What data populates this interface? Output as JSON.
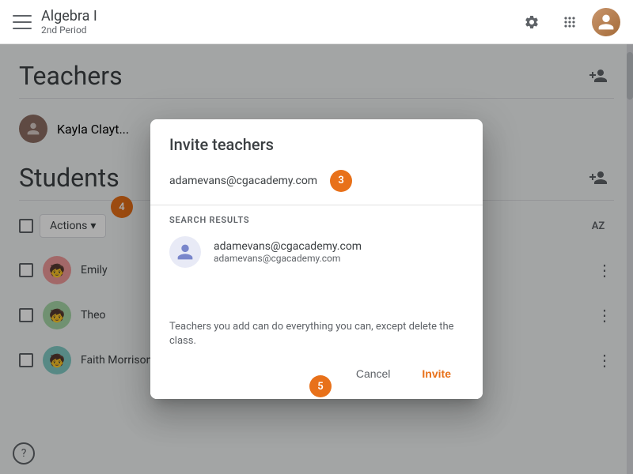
{
  "topbar": {
    "menu_icon": "☰",
    "title": "Algebra I",
    "subtitle": "2nd Period",
    "settings_icon": "⚙",
    "grid_icon": "⋮⋮",
    "avatar_label": "U"
  },
  "page": {
    "teachers_heading": "Teachers",
    "teacher_name": "Kayla Clayt...",
    "students_heading": "Students",
    "actions_label": "Actions",
    "actions_arrow": "›",
    "az_label": "AZ",
    "add_icon": "person_add",
    "students": [
      {
        "name": "Emily",
        "avatar_color": "#ef9a9a",
        "emoji": "👧"
      },
      {
        "name": "Theo",
        "avatar_color": "#a5d6a7",
        "emoji": "🧑"
      },
      {
        "name": "Faith Morrison",
        "avatar_color": "#80cbc4",
        "emoji": "👦"
      }
    ]
  },
  "dialog": {
    "title": "Invite teachers",
    "email_value": "adamevans@cgacademy.com",
    "step3_label": "3",
    "step4_label": "4",
    "step5_label": "5",
    "search_results_label": "SEARCH RESULTS",
    "result_name": "adamevans@cgacademy.com",
    "result_email": "adamevans@cgacademy.com",
    "note": "Teachers you add can do everything you can, except delete the class.",
    "cancel_label": "Cancel",
    "invite_label": "Invite"
  }
}
